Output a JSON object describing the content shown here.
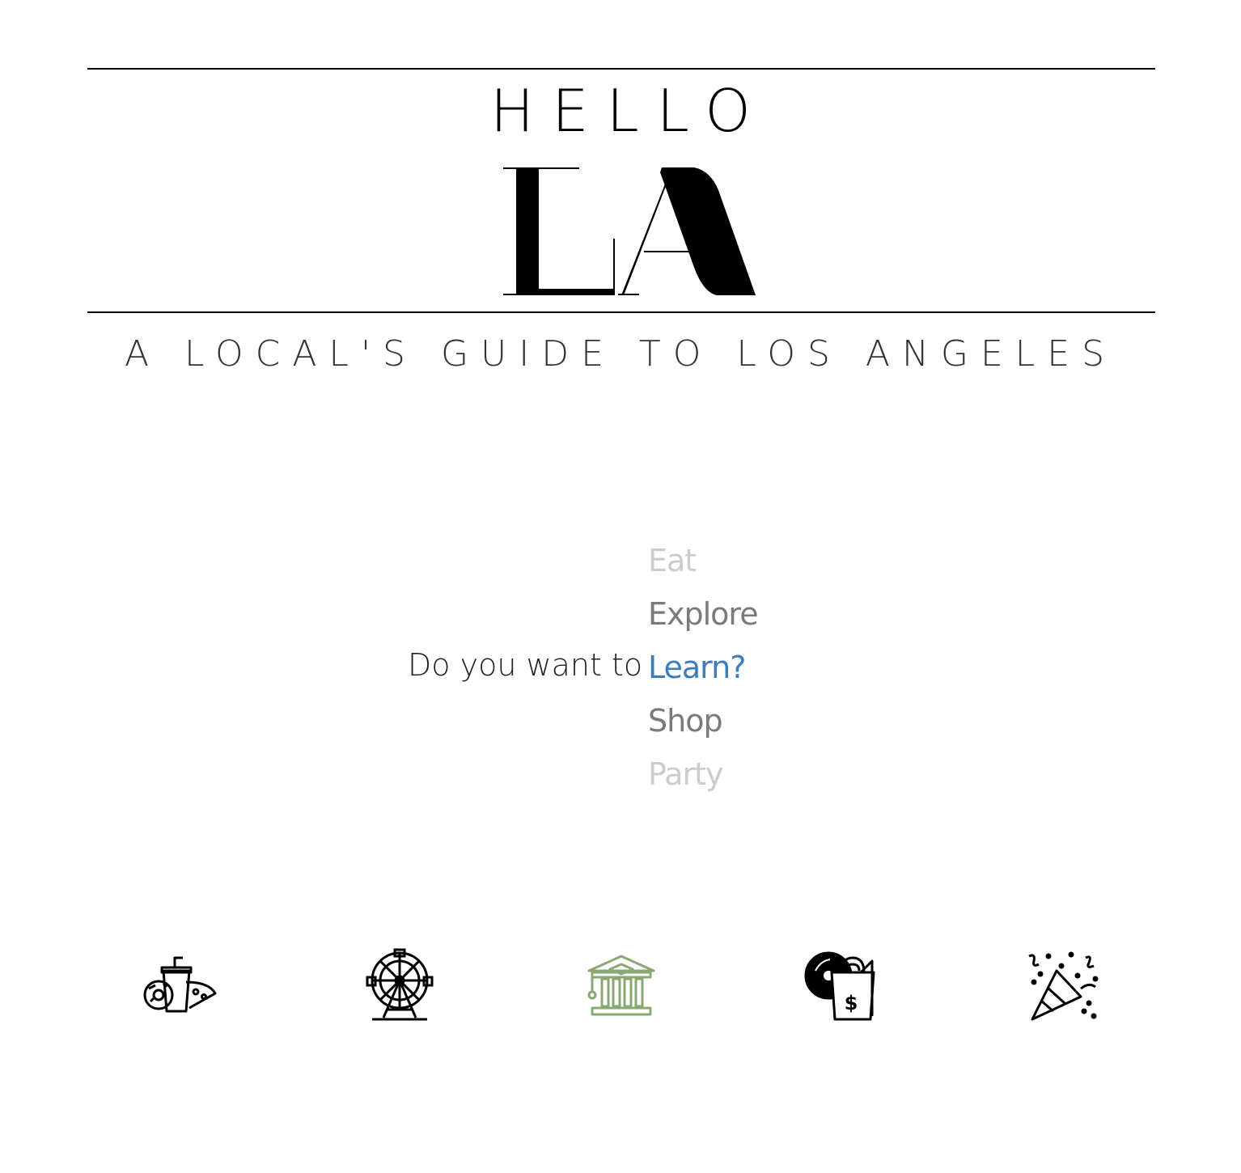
{
  "header": {
    "hello": "HELLO",
    "logo": "LA",
    "tagline": "A LOCAL'S GUIDE TO LOS ANGELES"
  },
  "prompt": {
    "question": "Do you want to",
    "options": [
      "Eat",
      "Explore",
      "Learn?",
      "Shop",
      "Party"
    ],
    "active_index": 2,
    "active_color": "#3a7ebf"
  },
  "icons": [
    {
      "name": "food-icon",
      "color": "#000000"
    },
    {
      "name": "ferris-wheel-icon",
      "color": "#000000"
    },
    {
      "name": "museum-icon",
      "color": "#8aa874"
    },
    {
      "name": "shopping-bag-icon",
      "color": "#000000"
    },
    {
      "name": "party-popper-icon",
      "color": "#000000"
    }
  ]
}
